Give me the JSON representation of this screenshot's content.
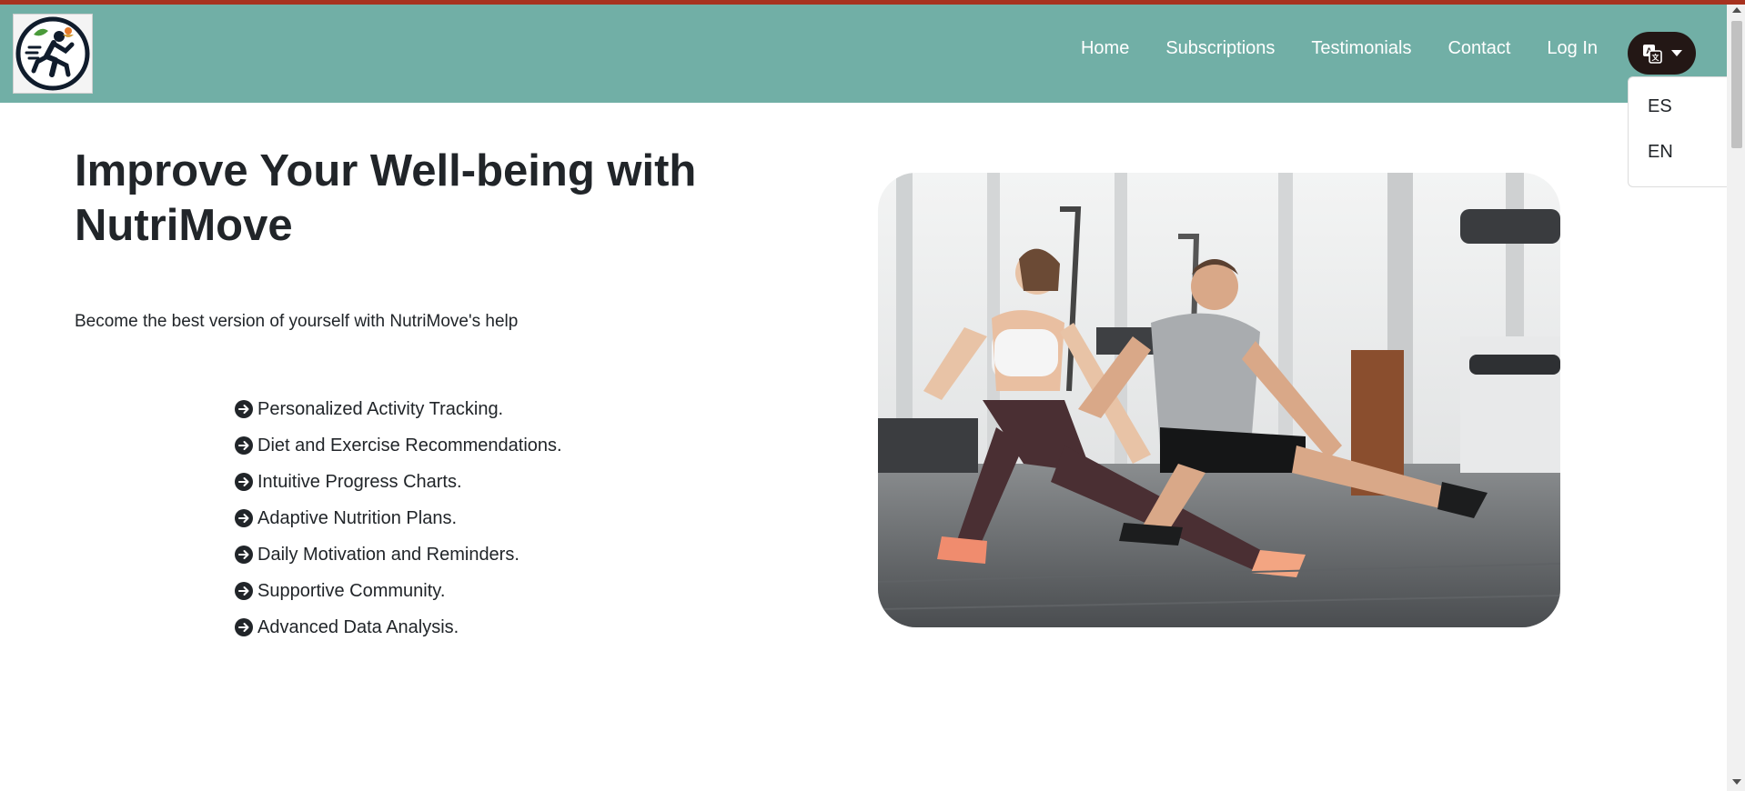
{
  "nav": {
    "links": [
      {
        "label": "Home"
      },
      {
        "label": "Subscriptions"
      },
      {
        "label": "Testimonials"
      },
      {
        "label": "Contact"
      },
      {
        "label": "Log In"
      }
    ],
    "language_button_icon": "translate-icon",
    "language_menu": [
      "ES",
      "EN"
    ]
  },
  "hero": {
    "title": "Improve Your Well-being with NutriMove",
    "subtitle": "Become the best version of yourself with NutriMove's help",
    "features": [
      "Personalized Activity Tracking.",
      "Diet and Exercise Recommendations.",
      "Intuitive Progress Charts.",
      "Adaptive Nutrition Plans.",
      "Daily Motivation and Reminders.",
      "Supportive Community.",
      "Advanced Data Analysis."
    ],
    "feature_icon": "arrow-circle-right-icon"
  },
  "colors": {
    "accent_bar": "#a7321f",
    "navbar": "#71afa6",
    "lang_button": "#231715",
    "text": "#212529"
  }
}
